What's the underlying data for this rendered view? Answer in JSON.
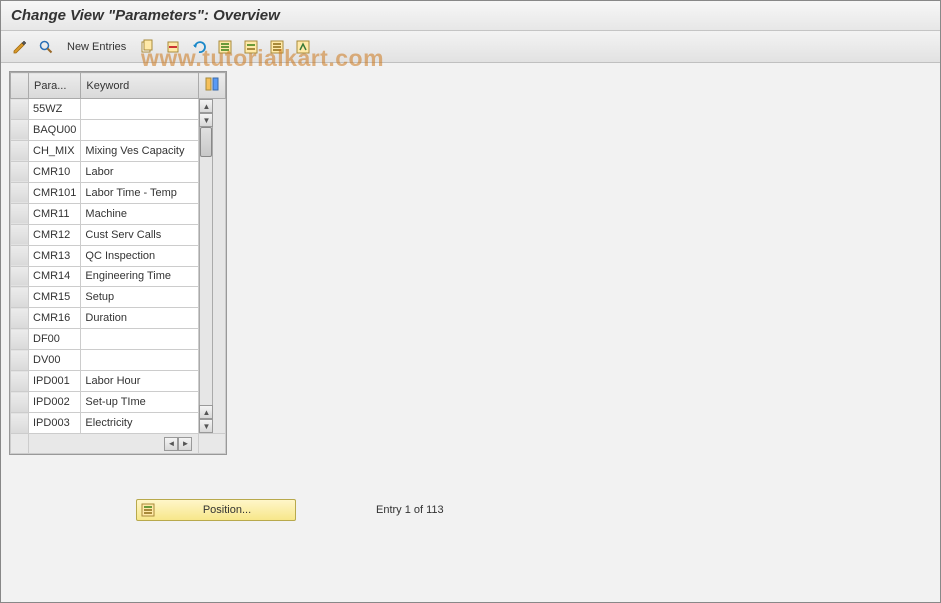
{
  "title": "Change View \"Parameters\": Overview",
  "watermark": "www.tutorialkart.com",
  "toolbar": {
    "new_entries_label": "New Entries"
  },
  "table": {
    "headers": {
      "param": "Para...",
      "keyword": "Keyword"
    },
    "rows": [
      {
        "param": "55WZ",
        "keyword": ""
      },
      {
        "param": "BAQU00",
        "keyword": ""
      },
      {
        "param": "CH_MIX",
        "keyword": "Mixing Ves Capacity"
      },
      {
        "param": "CMR10",
        "keyword": "Labor"
      },
      {
        "param": "CMR101",
        "keyword": "Labor Time - Temp"
      },
      {
        "param": "CMR11",
        "keyword": "Machine"
      },
      {
        "param": "CMR12",
        "keyword": "Cust Serv Calls"
      },
      {
        "param": "CMR13",
        "keyword": "QC Inspection"
      },
      {
        "param": "CMR14",
        "keyword": "Engineering Time"
      },
      {
        "param": "CMR15",
        "keyword": "Setup"
      },
      {
        "param": "CMR16",
        "keyword": "Duration"
      },
      {
        "param": "DF00",
        "keyword": ""
      },
      {
        "param": "DV00",
        "keyword": ""
      },
      {
        "param": "IPD001",
        "keyword": "Labor Hour"
      },
      {
        "param": "IPD002",
        "keyword": "Set-up TIme"
      },
      {
        "param": "IPD003",
        "keyword": "Electricity"
      }
    ]
  },
  "footer": {
    "position_label": "Position...",
    "entry_text": "Entry 1 of 113"
  }
}
